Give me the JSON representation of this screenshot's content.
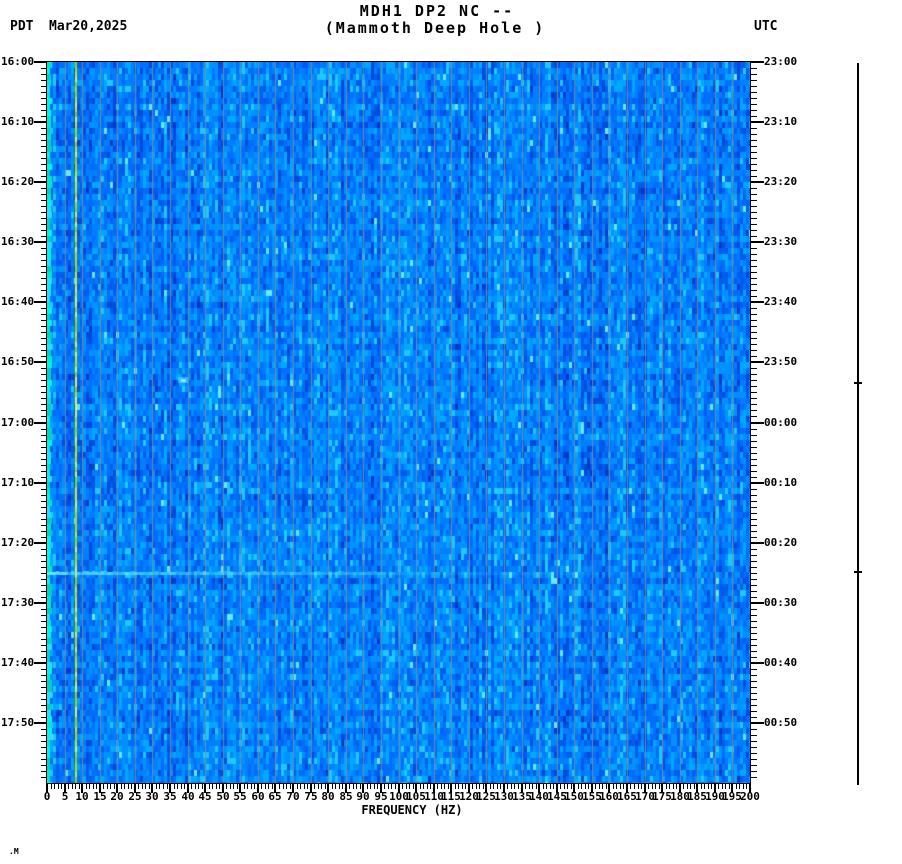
{
  "header": {
    "tz_left": "PDT",
    "date": "Mar20,2025",
    "title_line1": "MDH1 DP2 NC --",
    "title_line2": "(Mammoth Deep Hole )",
    "tz_right": "UTC"
  },
  "footer_glyph": ".M",
  "chart_data": {
    "type": "heatmap",
    "subtype": "seismic_spectrogram",
    "station_code": "MDH1 DP2 NC --",
    "station_name": "Mammoth Deep Hole",
    "date": "Mar20,2025",
    "x_axis": {
      "title": "FREQUENCY (HZ)",
      "min_hz": 0,
      "max_hz": 200,
      "major_tick_step_hz": 5,
      "minor_tick_step_hz": 1,
      "tick_labels": [
        "0",
        "5",
        "10",
        "15",
        "20",
        "25",
        "30",
        "35",
        "40",
        "45",
        "50",
        "55",
        "60",
        "65",
        "70",
        "75",
        "80",
        "85",
        "90",
        "95",
        "100",
        "105",
        "110",
        "115",
        "120",
        "125",
        "130",
        "135",
        "140",
        "145",
        "150",
        "155",
        "160",
        "165",
        "170",
        "175",
        "180",
        "185",
        "190",
        "195",
        "200"
      ]
    },
    "left_axis": {
      "timezone": "PDT",
      "start": "16:00",
      "end": "18:00",
      "total_minutes": 120,
      "major_tick_step_min": 10,
      "minor_tick_step_min": 1,
      "tick_labels": [
        "16:00",
        "16:10",
        "16:20",
        "16:30",
        "16:40",
        "16:50",
        "17:00",
        "17:10",
        "17:20",
        "17:30",
        "17:40",
        "17:50"
      ]
    },
    "right_axis": {
      "timezone": "UTC",
      "start": "23:00",
      "end": "01:00",
      "tick_labels": [
        "23:00",
        "23:10",
        "23:20",
        "23:30",
        "23:40",
        "23:50",
        "00:00",
        "00:10",
        "00:20",
        "00:30",
        "00:40",
        "00:50"
      ]
    },
    "scale_bar": {
      "tick_fractions": [
        0.442,
        0.704
      ]
    },
    "palette": {
      "noise_blues": [
        "#0038c8",
        "#004adc",
        "#005cee",
        "#006efc",
        "#007fff",
        "#0092ff",
        "#00a8ff",
        "#1fc8ff"
      ],
      "speckle_cyan": "#66e8ff",
      "grid_stripe": "rgba(125,140,150,0.85)",
      "low_freq_band": [
        "#00e8cc",
        "#00f6e0",
        "#2adcff",
        "#00d2c2"
      ],
      "narrowband_yellow": [
        "#b4dc00",
        "#c8ec14",
        "#9cd200",
        "#dcf542"
      ],
      "event_cyan_rgb": "95,235,255"
    },
    "features": [
      {
        "name": "low_frequency_band",
        "freq_hz": [
          0,
          1.2
        ],
        "description": "continuous strong low-frequency (microseism) energy along left edge"
      },
      {
        "name": "narrowband_line",
        "freq_hz": 8,
        "description": "persistent bright yellow-green monochromatic signal near 8 Hz for full 2 hours"
      },
      {
        "name": "grid_stripes",
        "every_hz": 5,
        "description": "faint gray vertical stripes every 5 Hz"
      },
      {
        "name": "broadband_event",
        "minutes_from_start": 84.8,
        "time_pdt": "17:24",
        "time_utc": "00:24",
        "strong_freq_extent_hz": [
          0,
          95
        ],
        "faint_freq_extent_hz": [
          95,
          185
        ],
        "description": "bright cyan horizontal broadband transient"
      },
      {
        "name": "small_transient",
        "minutes_from_start": 52.9,
        "time_pdt": "16:53",
        "freq_hz": 38.5,
        "description": "small faint cyan energy patch"
      }
    ]
  }
}
